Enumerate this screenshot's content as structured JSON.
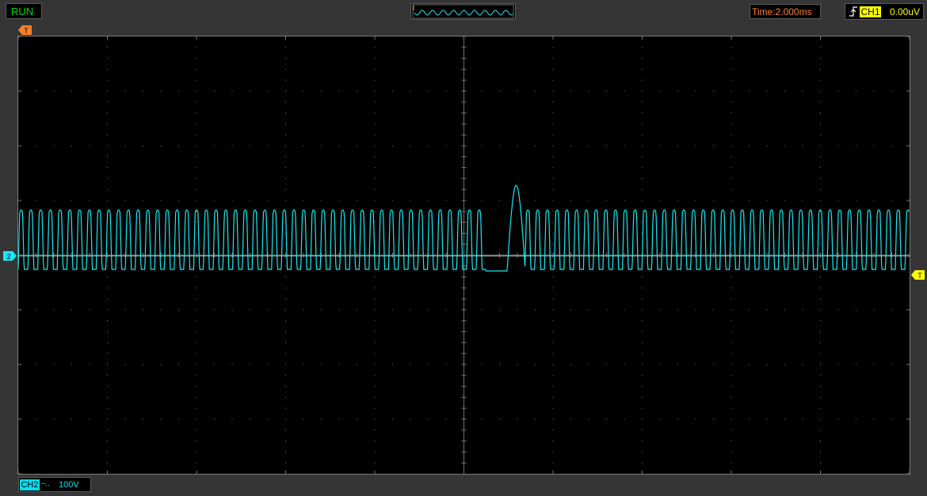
{
  "status": {
    "run_label": "RUN"
  },
  "timebase": {
    "label": "Time:2.000ms"
  },
  "trigger": {
    "edge_icon": "rising-edge-icon",
    "source": "CH1",
    "level": "0.00uV",
    "marker_label": "T"
  },
  "channel2": {
    "label": "CH2",
    "coupling_icon": "dc-coupling-icon",
    "scale": "100V",
    "marker_label": "2"
  },
  "colors": {
    "trace": "#18e8f4",
    "trigger_marker": "#ffff00",
    "time_marker": "#ff7f27",
    "run_text": "#00d800"
  }
}
